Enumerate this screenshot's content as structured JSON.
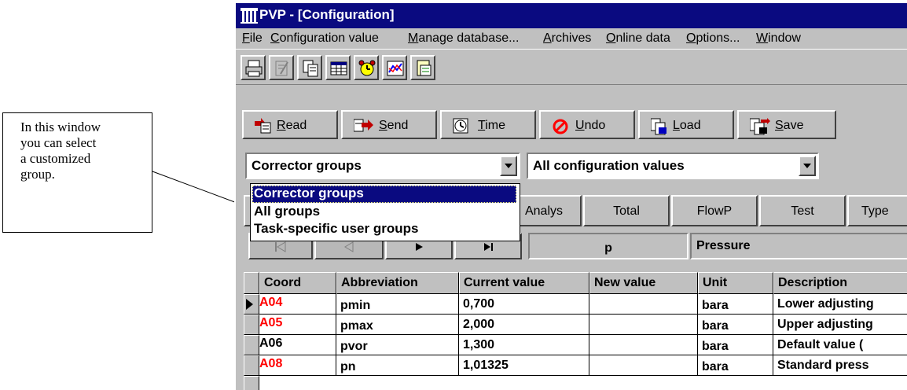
{
  "callout": {
    "lines": [
      "In this window",
      "you can select",
      "a customized",
      "group."
    ]
  },
  "window": {
    "title": "PVP - [Configuration]",
    "title_bar_color": "#0a0a80"
  },
  "menu": {
    "items": [
      {
        "label": "File",
        "mnemonic_index": 0
      },
      {
        "label": "Configuration value",
        "mnemonic_index": 0
      },
      {
        "label": "Manage database...",
        "mnemonic_index": 0
      },
      {
        "label": "Archives",
        "mnemonic_index": 0
      },
      {
        "label": "Online data",
        "mnemonic_index": 0
      },
      {
        "label": "Options...",
        "mnemonic_index": 0
      },
      {
        "label": "Window",
        "mnemonic_index": 0
      }
    ]
  },
  "toolbar_icons": [
    "print-icon",
    "edit-disabled-icon",
    "copy-icon",
    "table-icon",
    "alarm-clock-icon",
    "chart-icon",
    "note-icon"
  ],
  "action_buttons": [
    {
      "label": "Read",
      "icon": "read-icon"
    },
    {
      "label": "Send",
      "icon": "send-icon"
    },
    {
      "label": "Time",
      "icon": "clock-icon"
    },
    {
      "label": "Undo",
      "icon": "undo-icon"
    },
    {
      "label": "Load",
      "icon": "load-icon"
    },
    {
      "label": "Save",
      "icon": "save-icon"
    }
  ],
  "group_combo": {
    "value": "Corrector groups"
  },
  "values_combo": {
    "value": "All configuration values"
  },
  "dropdown": {
    "options": [
      "Corrector groups",
      "All groups",
      "Task-specific user groups"
    ],
    "selected_index": 0
  },
  "tabs": [
    "Analys",
    "Total",
    "FlowP",
    "Test",
    "Type"
  ],
  "navigator": {
    "buttons": [
      "first-record-icon",
      "prev-record-icon",
      "next-record-icon",
      "last-record-icon"
    ],
    "abbreviation": "p",
    "description": "Pressure"
  },
  "grid": {
    "columns": [
      "Coord",
      "Abbreviation",
      "Current value",
      "New value",
      "Unit",
      "Description"
    ],
    "rows": [
      {
        "coord": "A04",
        "coord_red": true,
        "abbr": "pmin",
        "current": "0,700",
        "new": "",
        "unit": "bara",
        "desc": "Lower adjusting",
        "current_row": true
      },
      {
        "coord": "A05",
        "coord_red": true,
        "abbr": "pmax",
        "current": "2,000",
        "new": "",
        "unit": "bara",
        "desc": "Upper adjusting",
        "current_row": false
      },
      {
        "coord": "A06",
        "coord_red": false,
        "abbr": "pvor",
        "current": "1,300",
        "new": "",
        "unit": "bara",
        "desc": "Default value (",
        "current_row": false
      },
      {
        "coord": "A08",
        "coord_red": true,
        "abbr": "pn",
        "current": "1,01325",
        "new": "",
        "unit": "bara",
        "desc": "Standard press",
        "current_row": false
      }
    ]
  }
}
